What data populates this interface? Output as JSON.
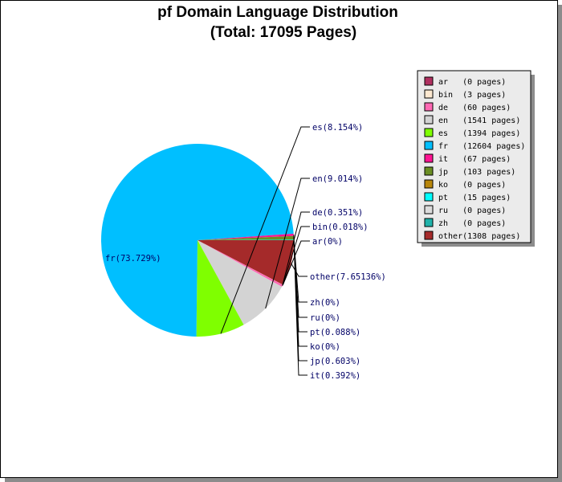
{
  "chart_data": {
    "type": "pie",
    "title": "pf Domain Language Distribution",
    "subtitle": "(Total: 17095 Pages)",
    "slices": [
      {
        "name": "other",
        "pages": 1308,
        "percent_label": "other(7.65136%)",
        "legend_label": "other(1308 pages)",
        "color": "#a52a2a"
      },
      {
        "name": "ar",
        "pages": 0,
        "percent_label": "ar(0%)",
        "legend_label": "ar   (0 pages)",
        "color": "#b03060"
      },
      {
        "name": "bin",
        "pages": 3,
        "percent_label": "bin(0.018%)",
        "legend_label": "bin  (3 pages)",
        "color": "#fde8d0"
      },
      {
        "name": "de",
        "pages": 60,
        "percent_label": "de(0.351%)",
        "legend_label": "de   (60 pages)",
        "color": "#ff69b4"
      },
      {
        "name": "en",
        "pages": 1541,
        "percent_label": "en(9.014%)",
        "legend_label": "en   (1541 pages)",
        "color": "#d3d3d3"
      },
      {
        "name": "es",
        "pages": 1394,
        "percent_label": "es(8.154%)",
        "legend_label": "es   (1394 pages)",
        "color": "#7fff00"
      },
      {
        "name": "fr",
        "pages": 12604,
        "percent_label": "fr(73.729%)",
        "legend_label": "fr   (12604 pages)",
        "color": "#00bfff"
      },
      {
        "name": "it",
        "pages": 67,
        "percent_label": "it(0.392%)",
        "legend_label": "it   (67 pages)",
        "color": "#ff1493"
      },
      {
        "name": "jp",
        "pages": 103,
        "percent_label": "jp(0.603%)",
        "legend_label": "jp   (103 pages)",
        "color": "#6b8e23"
      },
      {
        "name": "ko",
        "pages": 0,
        "percent_label": "ko(0%)",
        "legend_label": "ko   (0 pages)",
        "color": "#b8860b"
      },
      {
        "name": "pt",
        "pages": 15,
        "percent_label": "pt(0.088%)",
        "legend_label": "pt   (15 pages)",
        "color": "#00ffff"
      },
      {
        "name": "ru",
        "pages": 0,
        "percent_label": "ru(0%)",
        "legend_label": "ru   (0 pages)",
        "color": "#dcdcdc"
      },
      {
        "name": "zh",
        "pages": 0,
        "percent_label": "zh(0%)",
        "legend_label": "zh   (0 pages)",
        "color": "#20b2aa"
      }
    ],
    "legend_order": [
      "ar",
      "bin",
      "de",
      "en",
      "es",
      "fr",
      "it",
      "jp",
      "ko",
      "pt",
      "ru",
      "zh",
      "other"
    ],
    "legend_placement": "right"
  }
}
